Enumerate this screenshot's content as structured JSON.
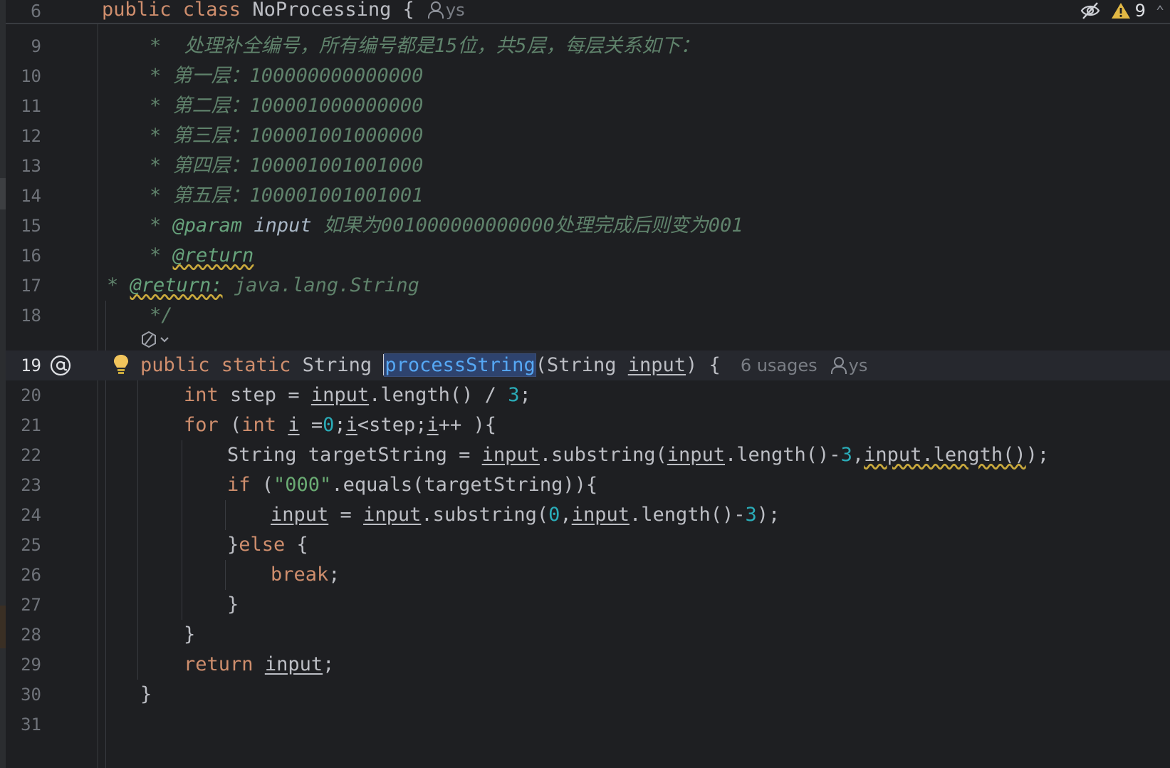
{
  "sticky": {
    "line": "6",
    "code": "public class NoProcessing {",
    "author": "ys"
  },
  "inspections": {
    "warnings": "9"
  },
  "doc_lines": [
    {
      "ln": "9",
      "star": "*  ",
      "text": "处理补全编号，所有编号都是15位，共5层，每层关系如下："
    },
    {
      "ln": "10",
      "star": "* ",
      "text": "第一层：100000000000000"
    },
    {
      "ln": "11",
      "star": "* ",
      "text": "第二层：100001000000000"
    },
    {
      "ln": "12",
      "star": "* ",
      "text": "第三层：100001001000000"
    },
    {
      "ln": "13",
      "star": "* ",
      "text": "第四层：100001001001000"
    },
    {
      "ln": "14",
      "star": "* ",
      "text": "第五层：100001001001001"
    }
  ],
  "param_line": {
    "ln": "15",
    "star": "* ",
    "tag": "@param",
    "name": " input ",
    "text": "如果为001000000000000处理完成后则变为001"
  },
  "return_line": {
    "ln": "16",
    "star": "* ",
    "tag": "@return"
  },
  "return2_line": {
    "ln": "17",
    "star": "* ",
    "tag": "@return:",
    "text": " java.lang.String"
  },
  "close_line": {
    "ln": "18",
    "text": "*/"
  },
  "method_line": {
    "ln": "19",
    "kw": "public static ",
    "type": "String ",
    "name": "processString",
    "open": "(String ",
    "param": "input",
    "close": ") {",
    "usages": "6 usages",
    "author": "ys"
  },
  "l20": {
    "ln": "20",
    "t1": "int",
    "t2": " step = ",
    "t3": "input",
    "t4": ".length() / ",
    "t5": "3",
    "t6": ";"
  },
  "l21": {
    "ln": "21",
    "t1": "for",
    "t2": " (",
    "t3": "int",
    "t4": " ",
    "t5": "i",
    "t6": " =",
    "t7": "0",
    "t8": ";",
    "t9": "i",
    "t10": "<step;",
    "t11": "i",
    "t12": "++ ){"
  },
  "l22": {
    "ln": "22",
    "t1": "String targetString = ",
    "t2": "input",
    "t3": ".substring(",
    "t4": "input",
    "t5": ".length()-",
    "t6": "3",
    "t7": ",",
    "t8": "input.length()",
    "t9": ");"
  },
  "l23": {
    "ln": "23",
    "t1": "if",
    "t2": " (",
    "t3": "\"000\"",
    "t4": ".equals(targetString)){"
  },
  "l24": {
    "ln": "24",
    "t1": "input",
    "t2": " = ",
    "t3": "input",
    "t4": ".substring(",
    "t5": "0",
    "t6": ",",
    "t7": "input",
    "t8": ".length()-",
    "t9": "3",
    "t10": ");"
  },
  "l25": {
    "ln": "25",
    "t1": "}",
    "t2": "else",
    "t3": " {"
  },
  "l26": {
    "ln": "26",
    "t1": "break",
    "t2": ";"
  },
  "l27": {
    "ln": "27",
    "t1": "}"
  },
  "l28": {
    "ln": "28",
    "t1": "}"
  },
  "l29": {
    "ln": "29",
    "t1": "return",
    "t2": " ",
    "t3": "input",
    "t4": ";"
  },
  "l30": {
    "ln": "30",
    "t1": "}"
  },
  "l31": {
    "ln": "31"
  },
  "colors": {
    "background": "#1e1f22",
    "keyword": "#cf8e6d",
    "number": "#2aacb8",
    "string": "#6aab73",
    "function": "#56a8f5",
    "doc_comment": "#5f826b",
    "warning": "#e2b844"
  }
}
